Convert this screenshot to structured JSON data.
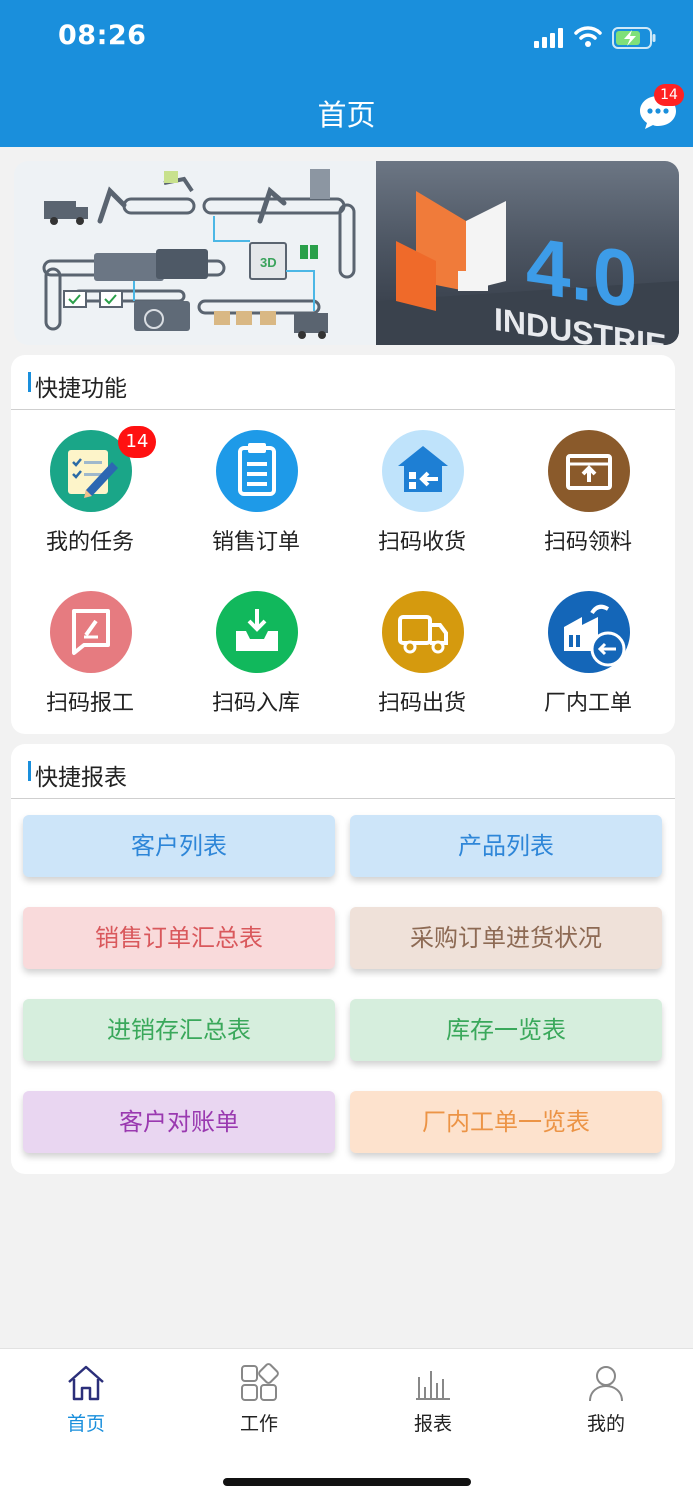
{
  "status_bar": {
    "time": "08:26"
  },
  "header": {
    "title": "首页",
    "message_count": "14"
  },
  "banner": {
    "right_text": "4.0",
    "right_caption": "INDUSTRIE",
    "box_label": "3D"
  },
  "quick_functions": {
    "title": "快捷功能",
    "items": [
      {
        "label": "我的任务",
        "icon": "task-icon",
        "color": "#1aa688",
        "badge": "14"
      },
      {
        "label": "销售订单",
        "icon": "clipboard-icon",
        "color": "#1e9ae8"
      },
      {
        "label": "扫码收货",
        "icon": "warehouse-receive-icon",
        "color": "#bfe3fb"
      },
      {
        "label": "扫码领料",
        "icon": "box-up-icon",
        "color": "#8a5a2b"
      },
      {
        "label": "扫码报工",
        "icon": "report-edit-icon",
        "color": "#e67b80"
      },
      {
        "label": "扫码入库",
        "icon": "inbox-download-icon",
        "color": "#11b85c"
      },
      {
        "label": "扫码出货",
        "icon": "truck-icon",
        "color": "#d59a0e"
      },
      {
        "label": "厂内工单",
        "icon": "factory-return-icon",
        "color": "#1466b8"
      }
    ]
  },
  "quick_reports": {
    "title": "快捷报表",
    "buttons": [
      {
        "label": "客户列表",
        "bg": "#cde5f9",
        "fg": "#2e86d8"
      },
      {
        "label": "产品列表",
        "bg": "#cde5f9",
        "fg": "#2e86d8"
      },
      {
        "label": "销售订单汇总表",
        "bg": "#f9dadb",
        "fg": "#d9585c"
      },
      {
        "label": "采购订单进货状况",
        "bg": "#efe1d9",
        "fg": "#8d6a54"
      },
      {
        "label": "进销存汇总表",
        "bg": "#d6eedd",
        "fg": "#3aa85b"
      },
      {
        "label": "库存一览表",
        "bg": "#d6eedd",
        "fg": "#3aa85b"
      },
      {
        "label": "客户对账单",
        "bg": "#e9d6f1",
        "fg": "#9a39b0"
      },
      {
        "label": "厂内工单一览表",
        "bg": "#fde2cd",
        "fg": "#ec9446"
      }
    ]
  },
  "tabbar": {
    "items": [
      {
        "label": "首页",
        "icon": "home-icon",
        "active": true
      },
      {
        "label": "工作",
        "icon": "apps-icon",
        "active": false
      },
      {
        "label": "报表",
        "icon": "bar-chart-icon",
        "active": false
      },
      {
        "label": "我的",
        "icon": "user-icon",
        "active": false
      }
    ],
    "active_color": "#1a8fdc"
  }
}
